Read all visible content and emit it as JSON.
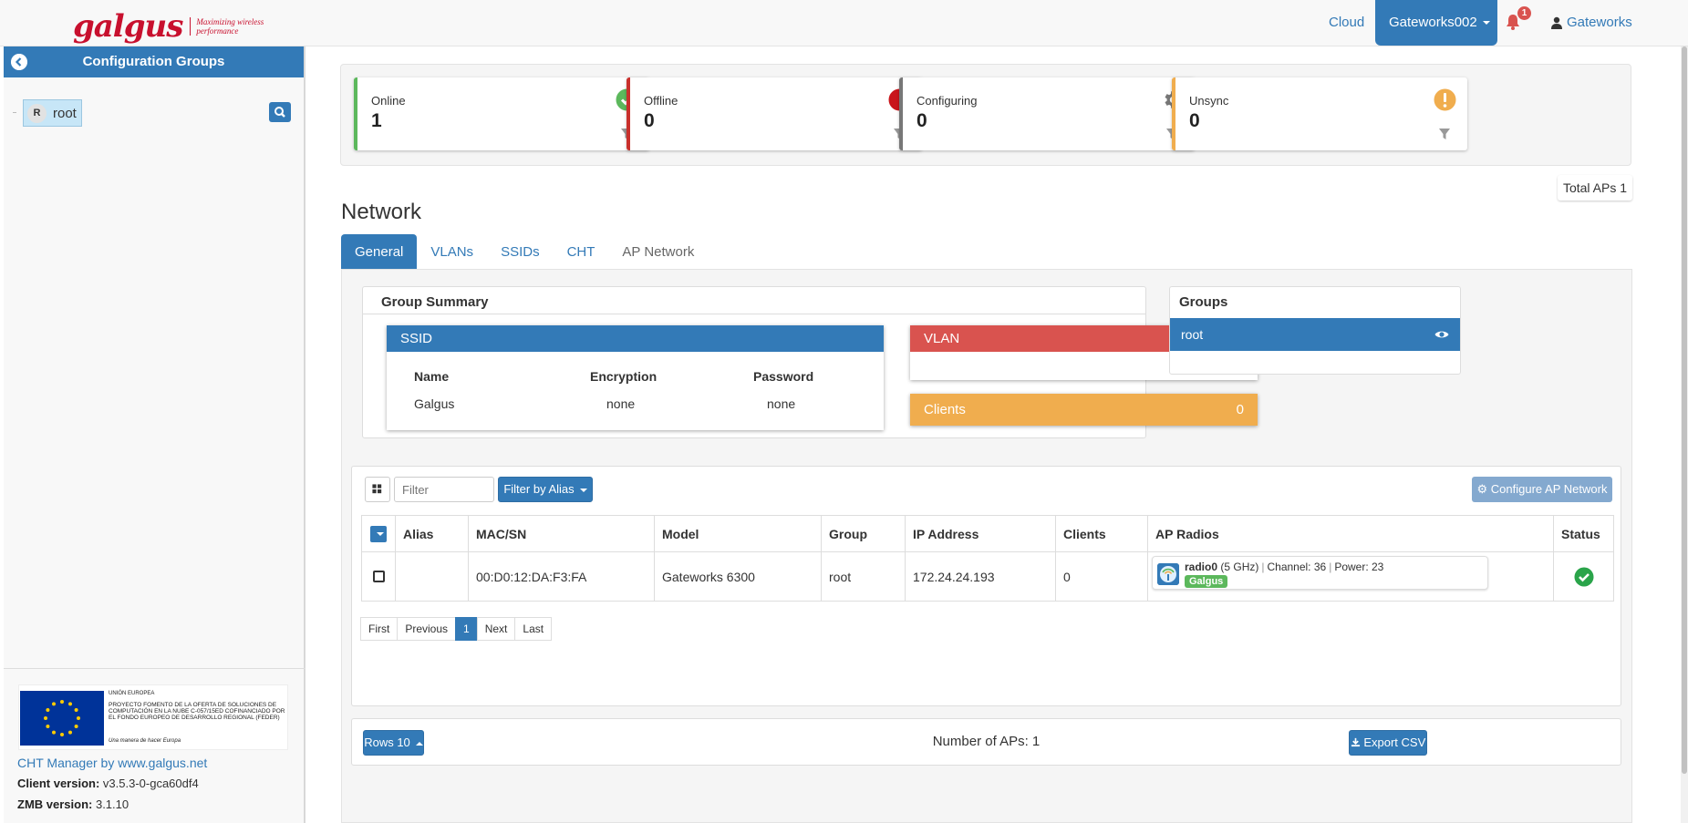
{
  "brand": {
    "name": "galgus",
    "tagline": "Maximizing wireless performance"
  },
  "topnav": {
    "cloud": "Cloud",
    "workspace": "Gateworks002",
    "notif_count": "1",
    "user": "Gateworks"
  },
  "sidebar": {
    "title": "Configuration Groups",
    "tree": [
      {
        "avatar": "R",
        "label": "root"
      }
    ],
    "eu": {
      "title": "UNIÓN EUROPEA",
      "text": "PROYECTO FOMENTO DE LA OFERTA DE SOLUCIONES DE COMPUTACIÓN EN LA NUBE C-057/15ED COFINANCIADO POR EL FONDO EUROPEO DE DESARROLLO REGIONAL (FEDER)",
      "slogan": "Una manera de hacer Europa"
    },
    "footer_link": "CHT Manager by www.galgus.net",
    "client_version_label": "Client version:",
    "client_version": "v3.5.3-0-gca60df4",
    "zmb_version_label": "ZMB version:",
    "zmb_version": "3.1.10"
  },
  "stats": [
    {
      "label": "Online",
      "value": "1",
      "color": "#5cb85c",
      "icon": "check-circle-icon"
    },
    {
      "label": "Offline",
      "value": "0",
      "color": "#c9302c",
      "icon": "red-dot-icon"
    },
    {
      "label": "Configuring",
      "value": "0",
      "color": "#777777",
      "icon": "gear-icon"
    },
    {
      "label": "Unsync",
      "value": "0",
      "color": "#f0ad4e",
      "icon": "exclamation-circle-icon"
    }
  ],
  "total_aps": "Total APs 1",
  "page_title": "Network",
  "tabs": [
    {
      "label": "General",
      "active": true
    },
    {
      "label": "VLANs"
    },
    {
      "label": "SSIDs"
    },
    {
      "label": "CHT"
    },
    {
      "label": "AP Network"
    }
  ],
  "summary": {
    "title": "Group Summary",
    "ssid": {
      "title": "SSID",
      "headers": [
        "Name",
        "Encryption",
        "Password"
      ],
      "rows": [
        [
          "Galgus",
          "none",
          "none"
        ]
      ]
    },
    "vlan": {
      "title": "VLAN"
    },
    "clients": {
      "label": "Clients",
      "count": "0"
    }
  },
  "groups": {
    "title": "Groups",
    "items": [
      "root"
    ]
  },
  "ap_table": {
    "filter_placeholder": "Filter",
    "filter_by": "Filter by Alias",
    "configure": "Configure AP Network",
    "headers": [
      "Alias",
      "MAC/SN",
      "Model",
      "Group",
      "IP Address",
      "Clients",
      "AP Radios",
      "Status"
    ],
    "rows": [
      {
        "alias": "",
        "mac": "00:D0:12:DA:F3:FA",
        "model": "Gateworks 6300",
        "group": "root",
        "ip": "172.24.24.193",
        "clients": "0",
        "radio": {
          "name": "radio0",
          "band": "(5 GHz)",
          "channel": "Channel: 36",
          "power": "Power: 23",
          "ssid": "Galgus"
        }
      }
    ],
    "pager": [
      "First",
      "Previous",
      "1",
      "Next",
      "Last"
    ]
  },
  "bottom": {
    "rows": "Rows 10",
    "count": "Number of APs: 1",
    "export": "Export CSV"
  }
}
